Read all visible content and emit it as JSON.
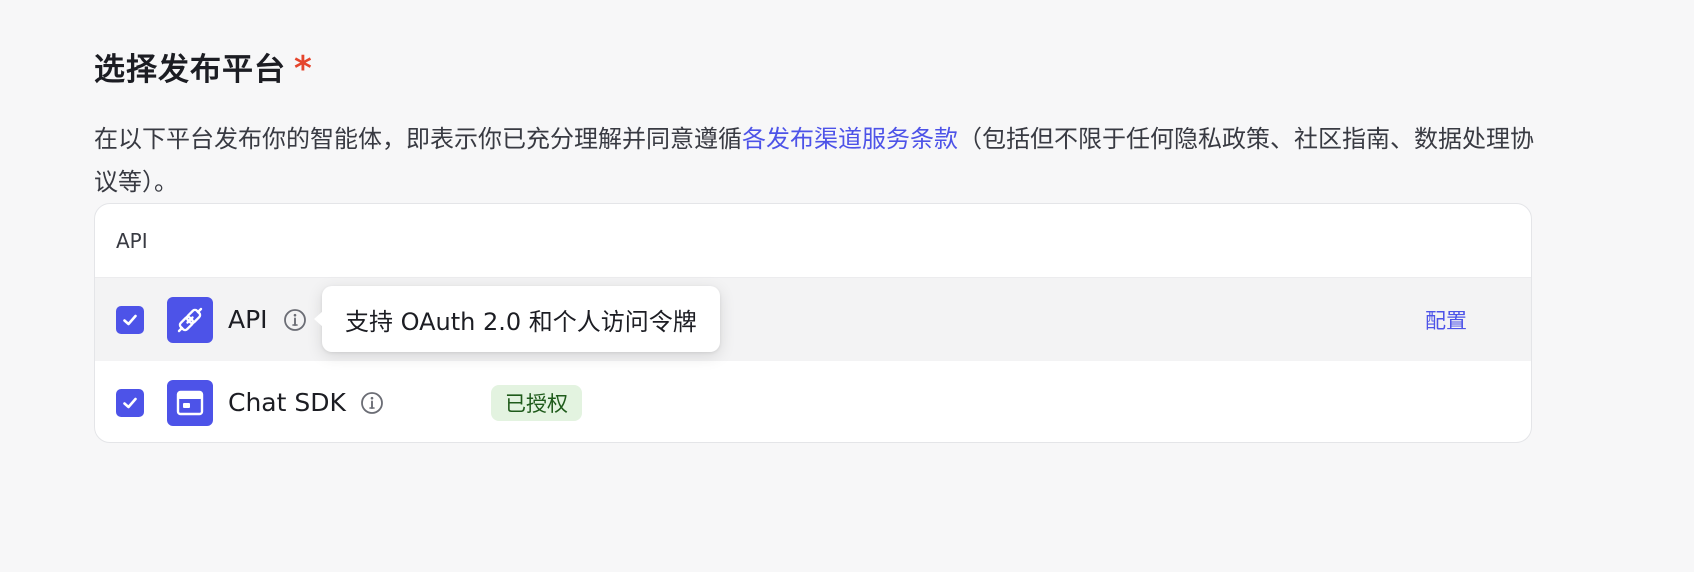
{
  "section": {
    "title": "选择发布平台",
    "required_mark": "*",
    "description_prefix": "在以下平台发布你的智能体，即表示你已充分理解并同意遵循",
    "description_link": "各发布渠道服务条款",
    "description_suffix": "（包括但不限于任何隐私政策、社区指南、数据处理协议等）。"
  },
  "card": {
    "header": "API",
    "rows": [
      {
        "name": "API",
        "icon": "link-icon",
        "checked": true,
        "action_label": "配置",
        "tooltip": "支持 OAuth 2.0 和个人访问令牌"
      },
      {
        "name": "Chat SDK",
        "icon": "browser-window-icon",
        "checked": true,
        "status_badge": "已授权"
      }
    ]
  },
  "colors": {
    "accent": "#4d53e8",
    "required": "#e5452c",
    "badge_bg": "#e3f3e0",
    "badge_text": "#1f5b1b"
  }
}
